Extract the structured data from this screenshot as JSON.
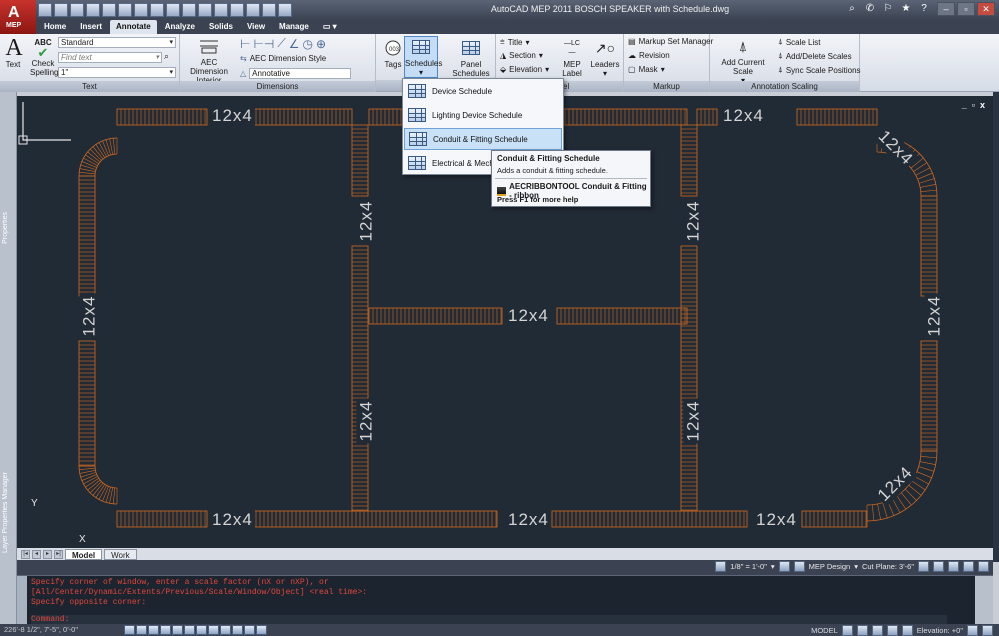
{
  "app": {
    "title": "AutoCAD MEP 2011   BOSCH SPEAKER with Schedule.dwg",
    "logo_letter": "A",
    "logo_sub": "MEP"
  },
  "tabs": [
    "Home",
    "Insert",
    "Annotate",
    "Analyze",
    "Solids",
    "View",
    "Manage"
  ],
  "active_tab": "Annotate",
  "ribbon": {
    "text_panel": {
      "title": "Text",
      "text_btn": "Text",
      "check_btn_line1": "Check",
      "check_btn_line2": "Spelling",
      "abc": "ABC",
      "style_combo": "Standard",
      "find_placeholder": "Find text",
      "height_combo": "1\""
    },
    "dimensions_panel": {
      "title": "Dimensions",
      "aec_btn_line1": "AEC Dimension",
      "aec_btn_line2": "Interior",
      "style_link": "AEC Dimension Style",
      "annotative": "Annotative"
    },
    "tags_btn": "Tags",
    "schedules_btn": "Schedules",
    "panel_schedules_btn": "Panel Schedules",
    "label_panel": {
      "title": "Label",
      "title_btn": "Title",
      "section_btn": "Section",
      "elevation_btn": "Elevation",
      "mep_label_line1": "MEP",
      "mep_label_line2": "Label",
      "mep_label_glyph": "—LC—",
      "leaders_btn": "Leaders"
    },
    "markup_panel": {
      "title": "Markup",
      "set_manager": "Markup Set Manager",
      "revision": "Revision",
      "mask": "Mask"
    },
    "annotation_scaling_panel": {
      "title": "Annotation Scaling",
      "add_current_scale": "Add Current Scale",
      "scale_list": "Scale List",
      "add_delete_scales": "Add/Delete Scales",
      "sync_scale_positions": "Sync Scale Positions"
    }
  },
  "dropdown": {
    "items": [
      {
        "label": "Device Schedule"
      },
      {
        "label": "Lighting Device Schedule"
      },
      {
        "label": "Conduit & Fitting Schedule"
      },
      {
        "label": "Electrical & Mechanic"
      }
    ]
  },
  "tooltip": {
    "title": "Conduit & Fitting Schedule",
    "description": "Adds a conduit & fitting schedule.",
    "command": "AECRIBBONTOOL Conduit & Fitting - ribbon",
    "help": "Press F1 for more help"
  },
  "side_palettes": {
    "properties": "Properties",
    "layer_manager": "Layer Properties Manager"
  },
  "drawing": {
    "tray_label": "12x4",
    "ucs_x": "X",
    "ucs_y": "Y",
    "viewport_controls": [
      "_",
      "▫",
      "x"
    ],
    "background_color": "#212b36",
    "tray_color": "#d2691e"
  },
  "layout_tabs": [
    "Model",
    "Work"
  ],
  "active_layout": "Model",
  "annotation_bar": {
    "scale": "1/8\" = 1'-0\"",
    "workspace": "MEP Design",
    "cut_plane": "Cut Plane:  3'-6\""
  },
  "command_window": {
    "lines": [
      "Specify corner of window, enter a scale factor (nX or nXP), or",
      "[All/Center/Dynamic/Extents/Previous/Scale/Window/Object] <real time>:",
      "Specify opposite corner:",
      "Command:"
    ]
  },
  "status_bar": {
    "coordinates": "226'-8 1/2\", 7'-5\", 0'-0\"",
    "model_label": "MODEL",
    "elevation": "Elevation: +0\""
  }
}
